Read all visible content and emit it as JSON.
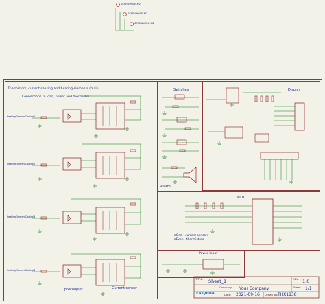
{
  "schematic": {
    "screw_holes": [
      "SCREWHOLE-M2",
      "SCREWHOLE-M2",
      "SCREWHOLE-M2"
    ],
    "sections": {
      "thermistors_title": "Thermistors, current sensing and heating elements (main)",
      "connections": "Connections to load, power and thermistor",
      "switches": "Switches",
      "display": "Display",
      "alarm": "Alarm",
      "mcu": "MCU",
      "power_input": "Power input",
      "optocoupler": "Optocoupler",
      "current_sensor": "Current sensor",
      "pin_note_odd": "aOdd - current sensors",
      "pin_note_even": "aEven - thermistors"
    },
    "net_labels": {
      "heating_1": "heatingElementControl1",
      "heating_2": "heatingElementControl2",
      "heating_3": "heatingElementControl3",
      "heating_4": "heatingElementControl4"
    },
    "title_block": {
      "title_label": "TITLE:",
      "title_value": "Sheet_1",
      "rev_label": "REV:",
      "rev_value": "1.0",
      "company_label": "Company:",
      "company_value": "Your Company",
      "sheet_label": "Sheet:",
      "sheet_value": "1/1",
      "date_label": "Date:",
      "date_value": "2021-09-16",
      "drawn_label": "Drawn By:",
      "drawn_value": "THX1138",
      "brand": "EasyEDA"
    },
    "colors": {
      "wire": "#0a7a0a",
      "part": "#8a1f1f",
      "label": "#1b2a86",
      "background": "#f3f2e9"
    }
  }
}
